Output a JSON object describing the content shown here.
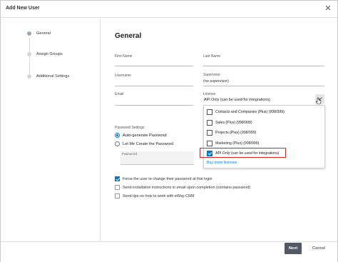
{
  "window": {
    "title": "Add New User",
    "close_icon": "close-icon"
  },
  "steps": [
    {
      "label": "General",
      "active": true
    },
    {
      "label": "Assign Groups",
      "active": false
    },
    {
      "label": "Additional Settings",
      "active": false
    }
  ],
  "form": {
    "heading": "General",
    "first_name_label": "First Name",
    "last_name_label": "Last Name",
    "username_label": "Username",
    "supervisor_label": "Supervisor",
    "supervisor_value": "(no supervisor)",
    "email_label": "Email",
    "license_label": "License",
    "license_value": "API Only (can be used for integrations)",
    "license_options": [
      {
        "label": "Contacts and Companies (Plus) (998/999)",
        "checked": false
      },
      {
        "label": "Sales (Plus) (998/999)",
        "checked": false
      },
      {
        "label": "Projects (Plus) (998/999)",
        "checked": false
      },
      {
        "label": "Marketing (Plus) (998/999)",
        "checked": false
      },
      {
        "label": "API Only (can be used for integrations)",
        "checked": true
      }
    ],
    "buy_more_link": "Buy more licenses",
    "password_settings_label": "Password Settings",
    "radio_auto": "Auto-generate Password",
    "radio_manual": "Let Me Create the Password",
    "password_field_label": "Password",
    "checks": [
      {
        "label": "Force the user to change their password at first login",
        "checked": true
      },
      {
        "label": "Send installation instructions in email upon completion (contains password)",
        "checked": false
      },
      {
        "label": "Send tips on how to work with eWay-CRM",
        "checked": false
      }
    ]
  },
  "footer": {
    "next_label": "Next",
    "cancel_label": "Cancel"
  },
  "colors": {
    "accent": "#0078d4",
    "highlight": "#d9241c",
    "primary_button": "#515a64"
  }
}
